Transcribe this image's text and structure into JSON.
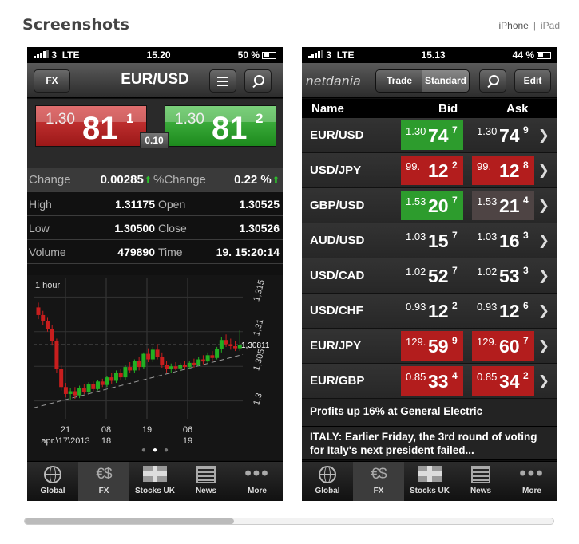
{
  "page": {
    "title": "Screenshots",
    "device_iphone": "iPhone",
    "device_sep": "|",
    "device_ipad": "iPad"
  },
  "left": {
    "status": {
      "carrier": "3",
      "network": "LTE",
      "time": "15.20",
      "battery": "50 %"
    },
    "nav": {
      "fx_button": "FX",
      "title": "EUR/USD"
    },
    "quote": {
      "bid_prefix": "1.30",
      "bid_big": "81",
      "bid_sup": "1",
      "ask_prefix": "1.30",
      "ask_big": "81",
      "ask_sup": "2",
      "spread": "0.10"
    },
    "stats": {
      "change_label": "Change",
      "change_value": "0.00285",
      "change_arrow": "⬆",
      "pct_label": "%Change",
      "pct_value": "0.22 %",
      "pct_arrow": "⬆",
      "high_label": "High",
      "high_value": "1.31175",
      "open_label": "Open",
      "open_value": "1.30525",
      "low_label": "Low",
      "low_value": "1.30500",
      "close_label": "Close",
      "close_value": "1.30526",
      "volume_label": "Volume",
      "volume_value": "479890",
      "time_label": "Time",
      "time_value": "19. 15:20:14"
    },
    "chart_data": {
      "type": "candlestick",
      "interval_label": "1 hour",
      "y_ticks": [
        "1,315",
        "1,31",
        "1,305",
        "1,3"
      ],
      "current_label": "1,30811",
      "x_ticks": [
        {
          "top": "21",
          "bottom": "apr.\\17\\2013"
        },
        {
          "top": "08",
          "bottom": "18"
        },
        {
          "top": "19",
          "bottom": ""
        },
        {
          "top": "06",
          "bottom": "19"
        }
      ],
      "ylim": [
        1.298,
        1.317
      ],
      "candles": [
        [
          1.3135,
          1.3142,
          1.3118,
          1.3124
        ],
        [
          1.3124,
          1.313,
          1.311,
          1.3115
        ],
        [
          1.3115,
          1.312,
          1.31,
          1.3104
        ],
        [
          1.3104,
          1.3109,
          1.308,
          1.3086
        ],
        [
          1.3086,
          1.309,
          1.304,
          1.3046
        ],
        [
          1.3046,
          1.3052,
          1.3015,
          1.302
        ],
        [
          1.302,
          1.3026,
          1.3005,
          1.301
        ],
        [
          1.301,
          1.3018,
          1.3002,
          1.3014
        ],
        [
          1.3014,
          1.302,
          1.3003,
          1.3008
        ],
        [
          1.3008,
          1.3022,
          1.3004,
          1.3019
        ],
        [
          1.3019,
          1.3024,
          1.301,
          1.3013
        ],
        [
          1.3013,
          1.3027,
          1.301,
          1.3024
        ],
        [
          1.3024,
          1.3028,
          1.3014,
          1.3017
        ],
        [
          1.3017,
          1.303,
          1.3015,
          1.3028
        ],
        [
          1.3028,
          1.3032,
          1.302,
          1.3023
        ],
        [
          1.3023,
          1.3036,
          1.302,
          1.3034
        ],
        [
          1.3034,
          1.304,
          1.3025,
          1.3029
        ],
        [
          1.3029,
          1.3044,
          1.3026,
          1.3041
        ],
        [
          1.3041,
          1.3046,
          1.303,
          1.3034
        ],
        [
          1.3034,
          1.3052,
          1.303,
          1.3049
        ],
        [
          1.3049,
          1.3056,
          1.304,
          1.3044
        ],
        [
          1.3044,
          1.306,
          1.304,
          1.3058
        ],
        [
          1.3058,
          1.3064,
          1.3044,
          1.3049
        ],
        [
          1.3049,
          1.307,
          1.3046,
          1.3068
        ],
        [
          1.3068,
          1.3076,
          1.3056,
          1.306
        ],
        [
          1.306,
          1.3078,
          1.3056,
          1.3074
        ],
        [
          1.3074,
          1.3082,
          1.306,
          1.3064
        ],
        [
          1.3064,
          1.307,
          1.3048,
          1.3052
        ],
        [
          1.3052,
          1.3058,
          1.304,
          1.3046
        ],
        [
          1.3046,
          1.3054,
          1.304,
          1.305
        ],
        [
          1.305,
          1.3056,
          1.3044,
          1.3047
        ],
        [
          1.3047,
          1.3055,
          1.3043,
          1.3052
        ],
        [
          1.3052,
          1.3058,
          1.3046,
          1.3049
        ],
        [
          1.3049,
          1.3058,
          1.3046,
          1.3055
        ],
        [
          1.3055,
          1.3061,
          1.3048,
          1.3052
        ],
        [
          1.3052,
          1.3063,
          1.305,
          1.306
        ],
        [
          1.306,
          1.3066,
          1.3053,
          1.3057
        ],
        [
          1.3057,
          1.307,
          1.3054,
          1.3066
        ],
        [
          1.3066,
          1.3072,
          1.3058,
          1.3062
        ],
        [
          1.3062,
          1.3078,
          1.306,
          1.3075
        ],
        [
          1.3075,
          1.3092,
          1.307,
          1.3088
        ],
        [
          1.3088,
          1.3096,
          1.3078,
          1.3082
        ],
        [
          1.3082,
          1.309,
          1.3074,
          1.3079
        ],
        [
          1.3079,
          1.3086,
          1.3072,
          1.3076
        ],
        [
          1.3076,
          1.3102,
          1.3072,
          1.3081
        ]
      ]
    },
    "tabs": [
      "Global",
      "FX",
      "Stocks UK",
      "News",
      "More"
    ]
  },
  "right": {
    "status": {
      "carrier": "3",
      "network": "LTE",
      "time": "15.13",
      "battery": "44 %"
    },
    "nav": {
      "logo": "netdania",
      "trade": "Trade",
      "standard": "Standard",
      "edit": "Edit"
    },
    "head": {
      "name": "Name",
      "bid": "Bid",
      "ask": "Ask"
    },
    "rates": [
      {
        "pair": "EUR/USD",
        "bid_p": "1.30",
        "bid_b": "74",
        "bid_s": "7",
        "bid_color": "green",
        "ask_p": "1.30",
        "ask_b": "74",
        "ask_s": "9",
        "ask_color": "none"
      },
      {
        "pair": "USD/JPY",
        "bid_p": "99.",
        "bid_b": "12",
        "bid_s": "2",
        "bid_color": "red",
        "ask_p": "99.",
        "ask_b": "12",
        "ask_s": "8",
        "ask_color": "red"
      },
      {
        "pair": "GBP/USD",
        "bid_p": "1.53",
        "bid_b": "20",
        "bid_s": "7",
        "bid_color": "green",
        "ask_p": "1.53",
        "ask_b": "21",
        "ask_s": "4",
        "ask_color": "grey"
      },
      {
        "pair": "AUD/USD",
        "bid_p": "1.03",
        "bid_b": "15",
        "bid_s": "7",
        "bid_color": "none",
        "ask_p": "1.03",
        "ask_b": "16",
        "ask_s": "3",
        "ask_color": "none"
      },
      {
        "pair": "USD/CAD",
        "bid_p": "1.02",
        "bid_b": "52",
        "bid_s": "7",
        "bid_color": "none",
        "ask_p": "1.02",
        "ask_b": "53",
        "ask_s": "3",
        "ask_color": "none"
      },
      {
        "pair": "USD/CHF",
        "bid_p": "0.93",
        "bid_b": "12",
        "bid_s": "2",
        "bid_color": "none",
        "ask_p": "0.93",
        "ask_b": "12",
        "ask_s": "6",
        "ask_color": "none"
      },
      {
        "pair": "EUR/JPY",
        "bid_p": "129.",
        "bid_b": "59",
        "bid_s": "9",
        "bid_color": "red",
        "ask_p": "129.",
        "ask_b": "60",
        "ask_s": "7",
        "ask_color": "red"
      },
      {
        "pair": "EUR/GBP",
        "bid_p": "0.85",
        "bid_b": "33",
        "bid_s": "4",
        "bid_color": "red",
        "ask_p": "0.85",
        "ask_b": "34",
        "ask_s": "2",
        "ask_color": "red"
      }
    ],
    "headline1": "Profits up 16% at General Electric",
    "headline2": "ITALY: Earlier Friday, the 3rd round of voting for Italy's next president failed...",
    "tabs": [
      "Global",
      "FX",
      "Stocks UK",
      "News",
      "More"
    ]
  }
}
